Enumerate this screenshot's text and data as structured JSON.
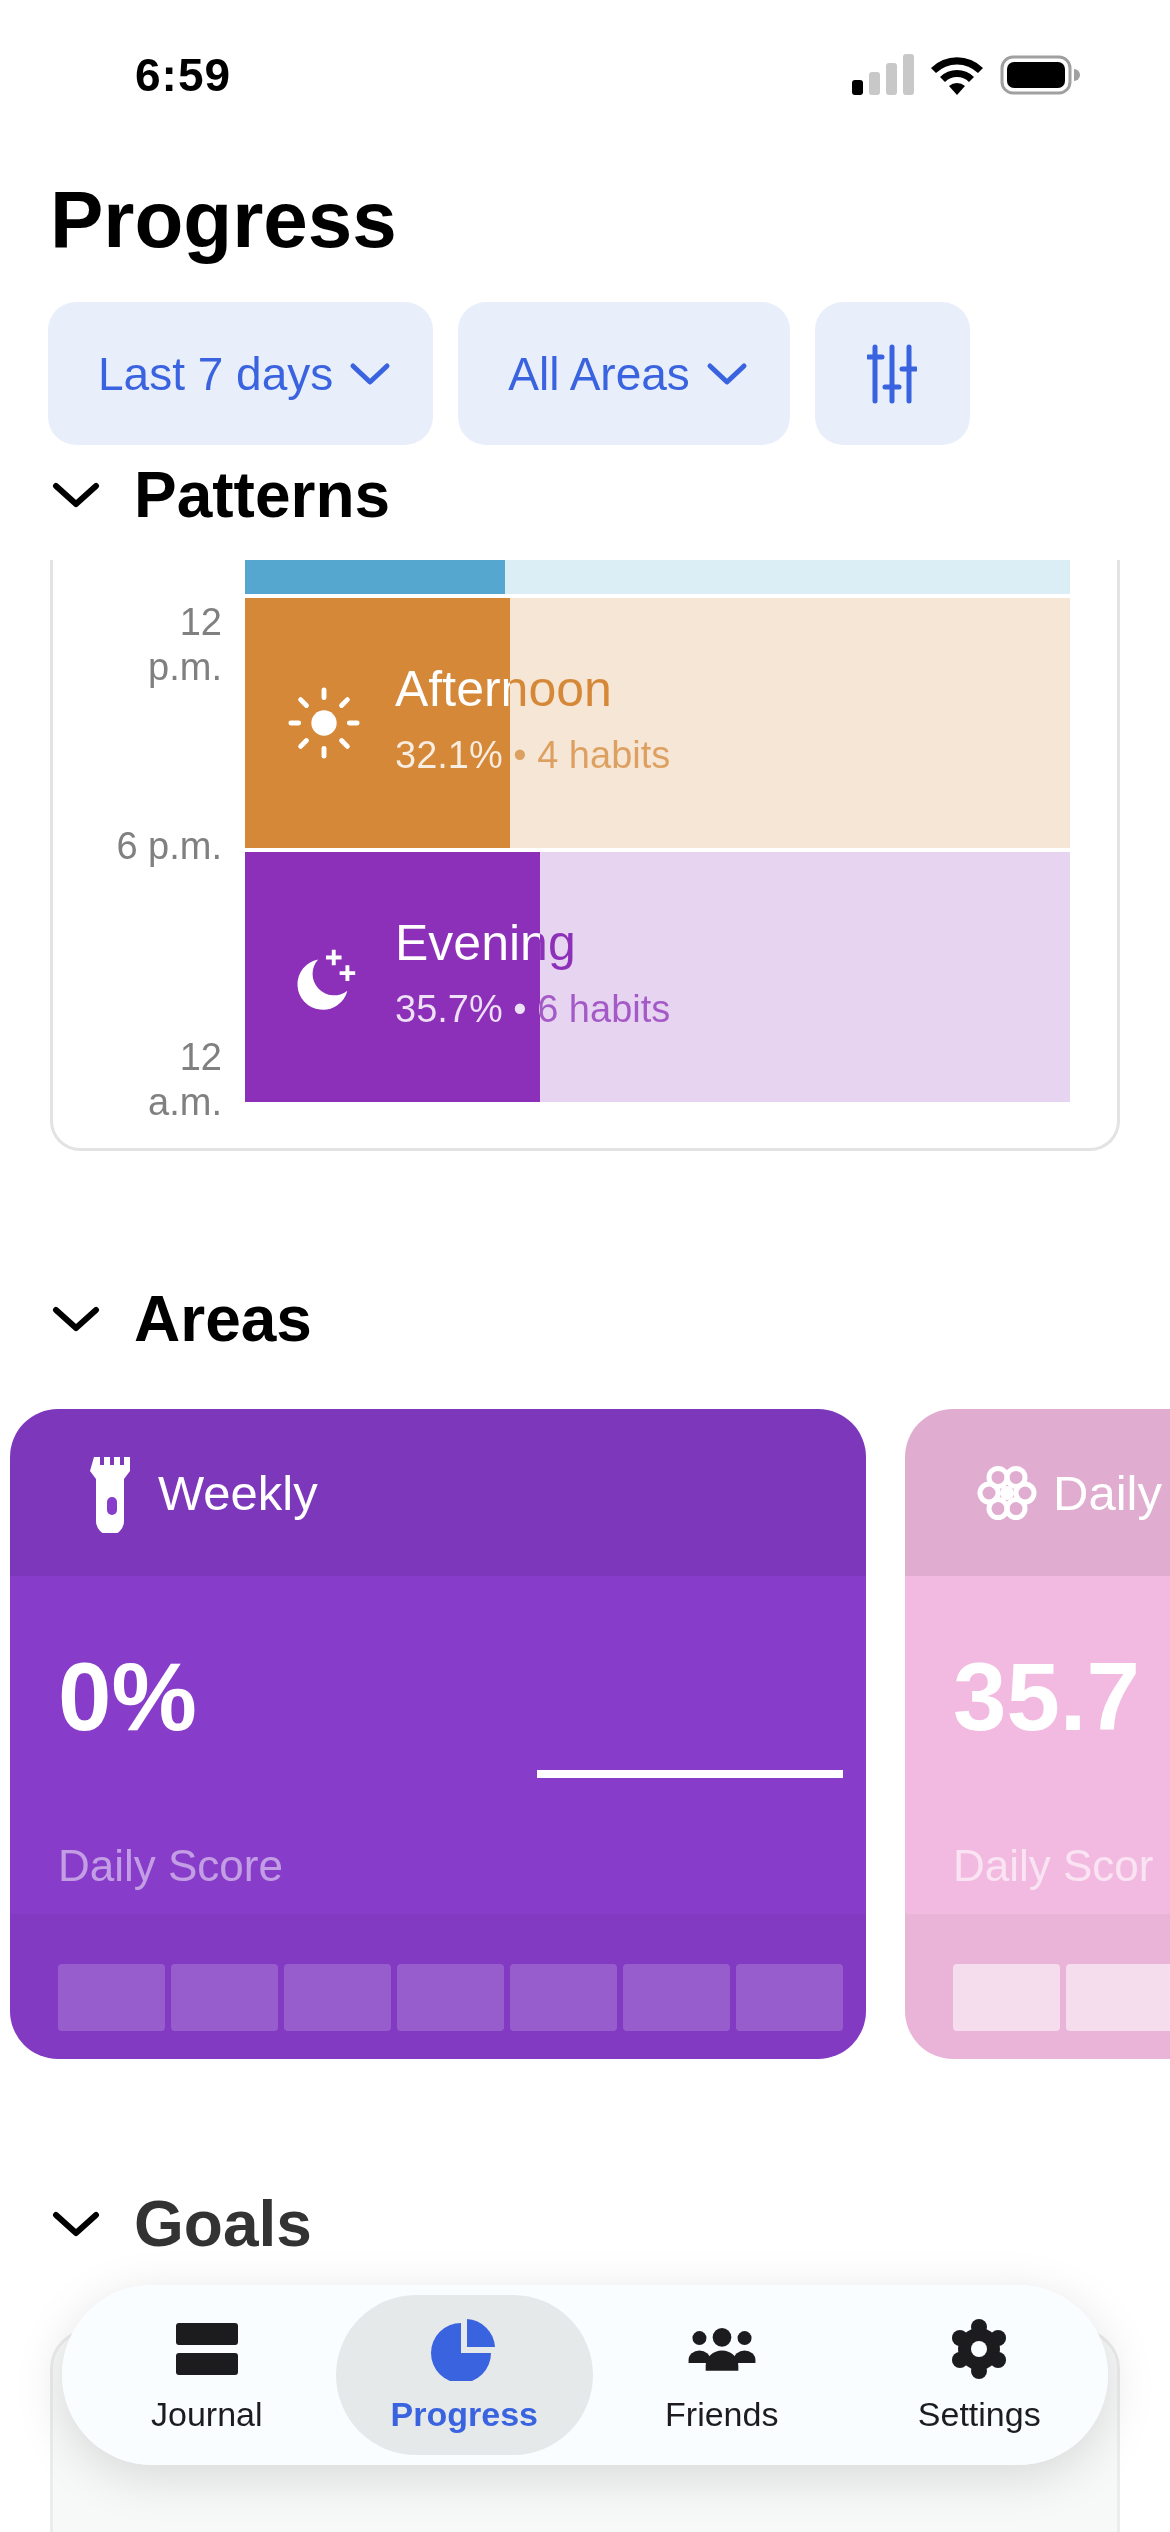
{
  "status_bar": {
    "time": "6:59"
  },
  "title": "Progress",
  "filters": [
    {
      "kind": "dropdown",
      "label": "Last 7 days"
    },
    {
      "kind": "dropdown",
      "label": "All Areas"
    },
    {
      "kind": "sliders"
    }
  ],
  "patterns": {
    "heading": "Patterns",
    "expanded": true,
    "axis_labels": [
      "12 p.m.",
      "6 p.m.",
      "12 a.m."
    ],
    "rows": [
      {
        "level": 0.315,
        "color": "#55a7cf"
      },
      {
        "kind": "sun",
        "name": "Afternoon",
        "detail": "32.1% • 4 habits",
        "level": 0.321,
        "color": "#d58838"
      },
      {
        "kind": "moon",
        "name": "Evening",
        "detail": "35.7% • 6 habits",
        "level": 0.357,
        "color": "#8c30b9"
      }
    ]
  },
  "areas": {
    "heading": "Areas",
    "expanded": true,
    "cards": [
      {
        "kind": "flashlight",
        "name": "Weekly",
        "value": "0%",
        "trend_line": true,
        "score_label": "Daily Score",
        "color": "#873cca",
        "days": [
          {
            "done": false
          },
          {
            "done": false
          },
          {
            "done": false
          },
          {
            "done": false
          },
          {
            "done": false
          },
          {
            "done": false
          },
          {
            "done": false
          }
        ]
      },
      {
        "kind": "flower",
        "name": "Daily",
        "value": "35.7",
        "score_label": "Daily Scor",
        "color": "#f2bae0",
        "days": [
          {
            "done": false
          },
          {
            "done": false
          }
        ]
      }
    ]
  },
  "goals": {
    "heading": "Goals",
    "expanded": true
  },
  "tabs": [
    {
      "kind": "journal",
      "label": "Journal",
      "selected": false
    },
    {
      "kind": "progress",
      "label": "Progress",
      "selected": true
    },
    {
      "kind": "friends",
      "label": "Friends",
      "selected": false
    },
    {
      "kind": "settings",
      "label": "Settings",
      "selected": false
    }
  ]
}
